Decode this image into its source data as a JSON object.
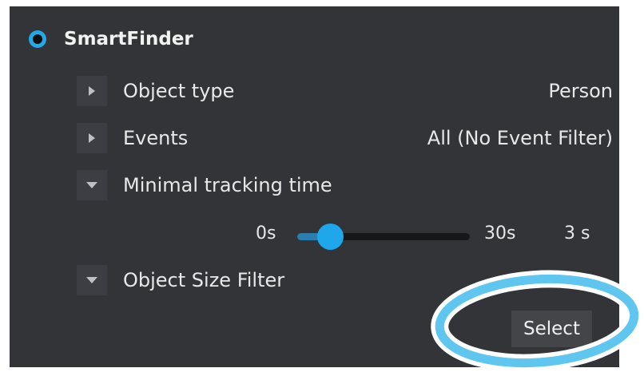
{
  "header": {
    "title": "SmartFinder",
    "radio_selected": true,
    "accent_color": "#23a9e6"
  },
  "rows": [
    {
      "label": "Object type",
      "value": "Person",
      "expanded": false
    },
    {
      "label": "Events",
      "value": "All (No Event Filter)",
      "expanded": false
    },
    {
      "label": "Minimal tracking time",
      "value": "",
      "expanded": true
    },
    {
      "label": "Object Size Filter",
      "value": "",
      "expanded": true
    }
  ],
  "slider": {
    "min_label": "0s",
    "max_label": "30s",
    "value_label": "3 s",
    "min": 0,
    "max": 30,
    "value": 3
  },
  "select_button": {
    "label": "Select"
  },
  "colors": {
    "panel_bg": "#333438",
    "highlight_ring": "#5ec6ef"
  }
}
